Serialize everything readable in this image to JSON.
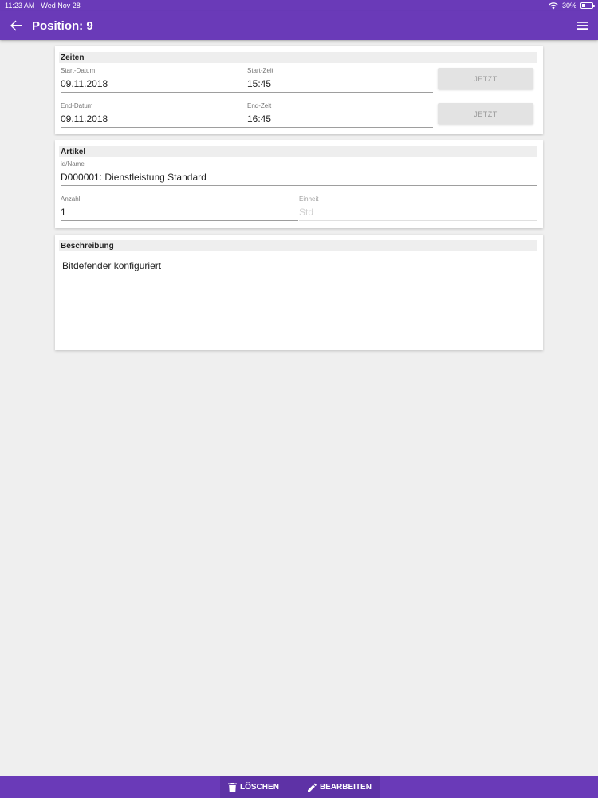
{
  "status_bar": {
    "time": "11:23 AM",
    "date": "Wed Nov 28",
    "battery": "30%",
    "icons": [
      "wifi-icon",
      "battery-icon"
    ]
  },
  "app_bar": {
    "title": "Position: 9",
    "icons": [
      "back-arrow-icon",
      "menu-icon"
    ]
  },
  "zeiten": {
    "header": "Zeiten",
    "start_date_label": "Start-Datum",
    "start_date_value": "09.11.2018",
    "start_time_label": "Start-Zeit",
    "start_time_value": "15:45",
    "start_now_label": "JETZT",
    "end_date_label": "End-Datum",
    "end_date_value": "09.11.2018",
    "end_time_label": "End-Zeit",
    "end_time_value": "16:45",
    "end_now_label": "JETZT"
  },
  "artikel": {
    "header": "Artikel",
    "id_label": "id/Name",
    "id_value": "D000001: Dienstleistung Standard",
    "anzahl_label": "Anzahl",
    "anzahl_value": "1",
    "einheit_label": "Einheit",
    "einheit_value": "Std"
  },
  "beschreibung": {
    "header": "Beschreibung",
    "text": "Bitdefender konfiguriert"
  },
  "bottom_bar": {
    "delete_label": "LÖSCHEN",
    "edit_label": "BEARBEITEN",
    "icons": [
      "trash-icon",
      "pencil-icon"
    ]
  },
  "colors": {
    "primary": "#6a3ab8",
    "background": "#efefef",
    "card": "#ffffff"
  }
}
